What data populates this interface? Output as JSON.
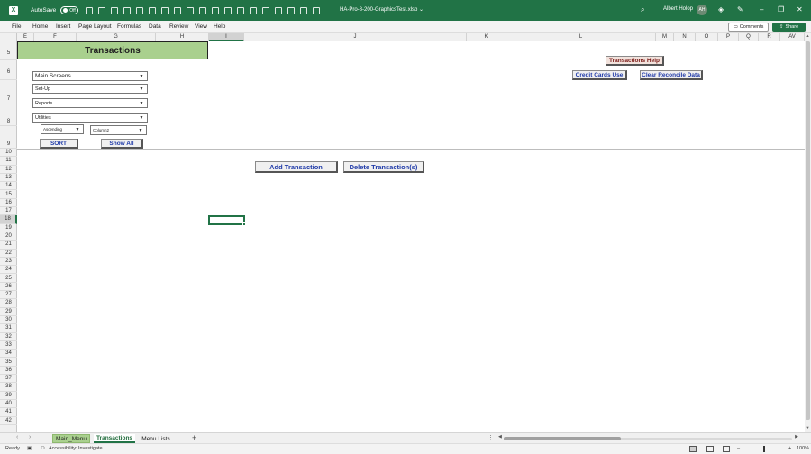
{
  "titlebar": {
    "autosave_label": "AutoSave",
    "autosave_state": "Off",
    "filename": "HA-Pro-8-200-GraphicsTest.xlsb ⌄",
    "user_name": "Albert Holop",
    "user_initials": "AH",
    "win_minimize": "–",
    "win_restore": "❐",
    "win_close": "✕"
  },
  "menu": {
    "items": [
      "File",
      "Home",
      "Insert",
      "Page Layout",
      "Formulas",
      "Data",
      "Review",
      "View",
      "Help"
    ],
    "comments_label": "Comments",
    "share_label": "Share"
  },
  "columns": [
    "E",
    "F",
    "G",
    "H",
    "I",
    "J",
    "K",
    "L",
    "M",
    "N",
    "O",
    "P",
    "Q",
    "R",
    "AV"
  ],
  "rows": [
    "5",
    "6",
    "7",
    "8",
    "9",
    "10",
    "11",
    "12",
    "13",
    "14",
    "15",
    "16",
    "17",
    "18",
    "19",
    "20",
    "21",
    "22",
    "23",
    "24",
    "25",
    "26",
    "27",
    "28",
    "29",
    "30",
    "31",
    "32",
    "33",
    "34",
    "35",
    "36",
    "37",
    "38",
    "39",
    "40",
    "41",
    "42"
  ],
  "selected_row": "18",
  "selected_column": "I",
  "sheet": {
    "banner_title": "Transactions",
    "dropdowns": {
      "main_screens": "Main Screens",
      "set_up": "Set-Up",
      "reports": "Reports",
      "utilities": "Utilities",
      "sort_order": "Ascending",
      "sort_column": "Column2"
    },
    "buttons": {
      "sort": "SORT",
      "show_all": "Show All",
      "transactions_help": "Transactions Help",
      "credit_cards_use": "Credit Cards Use",
      "clear_reconcile": "Clear Reconcile Data",
      "add_transaction": "Add Transaction",
      "delete_transaction": "Delete Transaction(s)"
    }
  },
  "tabs": {
    "items": [
      "Main_Menu",
      "Transactions",
      "Menu Lists"
    ],
    "active": "Transactions",
    "add_label": "+"
  },
  "status": {
    "ready": "Ready",
    "accessibility": "Accessibility: Investigate",
    "zoom_minus": "–",
    "zoom_plus": "+",
    "zoom": "100%"
  },
  "colors": {
    "brand": "#217346",
    "banner": "#a9d08e",
    "button_text": "#1f3aa8",
    "help_text": "#7a1b18"
  }
}
